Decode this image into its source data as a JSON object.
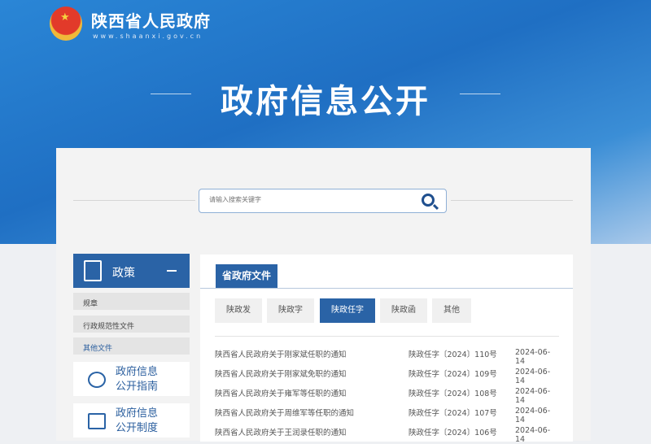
{
  "header": {
    "site_name": "陕西省人民政府",
    "site_url": "www.shaanxi.gov.cn",
    "page_title": "政府信息公开"
  },
  "search": {
    "placeholder": "请输入搜索关键字"
  },
  "sidebar": {
    "section": "政策",
    "items": [
      "规章",
      "行政规范性文件",
      "其他文件"
    ],
    "cards": [
      {
        "line1": "政府信息",
        "line2": "公开指南"
      },
      {
        "line1": "政府信息",
        "line2": "公开制度"
      }
    ]
  },
  "content": {
    "tab": "省政府文件",
    "subtabs": [
      "陕政发",
      "陕政字",
      "陕政任字",
      "陕政函",
      "其他"
    ],
    "active_subtab": "陕政任字",
    "rows": [
      {
        "title": "陕西省人民政府关于刚家斌任职的通知",
        "doc_no": "陕政任字〔2024〕110号",
        "date": "2024-06-14"
      },
      {
        "title": "陕西省人民政府关于刚家斌免职的通知",
        "doc_no": "陕政任字〔2024〕109号",
        "date": "2024-06-14"
      },
      {
        "title": "陕西省人民政府关于雍军等任职的通知",
        "doc_no": "陕政任字〔2024〕108号",
        "date": "2024-06-14"
      },
      {
        "title": "陕西省人民政府关于周维军等任职的通知",
        "doc_no": "陕政任字〔2024〕107号",
        "date": "2024-06-14"
      },
      {
        "title": "陕西省人民政府关于王润录任职的通知",
        "doc_no": "陕政任字〔2024〕106号",
        "date": "2024-06-14"
      }
    ]
  }
}
